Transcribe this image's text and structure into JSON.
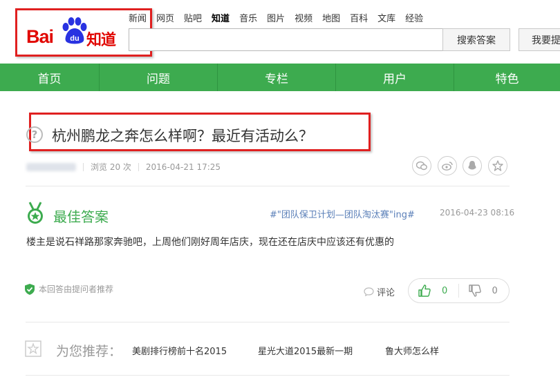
{
  "header": {
    "logo_text_bai": "Bai",
    "logo_text_du": "du",
    "logo_text_zhidao": "知道",
    "topnav": [
      {
        "label": "新闻",
        "active": false
      },
      {
        "label": "网页",
        "active": false
      },
      {
        "label": "贴吧",
        "active": false
      },
      {
        "label": "知道",
        "active": true
      },
      {
        "label": "音乐",
        "active": false
      },
      {
        "label": "图片",
        "active": false
      },
      {
        "label": "视频",
        "active": false
      },
      {
        "label": "地图",
        "active": false
      },
      {
        "label": "百科",
        "active": false
      },
      {
        "label": "文库",
        "active": false
      },
      {
        "label": "经验",
        "active": false
      }
    ],
    "search_value": "",
    "search_button": "搜索答案",
    "ask_button": "我要提问"
  },
  "mainnav": [
    "首页",
    "问题",
    "专栏",
    "用户",
    "特色"
  ],
  "question": {
    "title": "杭州鹏龙之奔怎么样啊？最近有活动么？",
    "views": "浏览 20 次",
    "date": "2016-04-21 17:25",
    "share_icons": [
      "wechat-icon",
      "weibo-icon",
      "qq-icon",
      "favorite-star-icon"
    ]
  },
  "best_answer": {
    "label": "最佳答案",
    "tag": "#\"团队保卫计划—团队淘汰赛\"ing#",
    "date": "2016-04-23 08:16",
    "text": "楼主是说石祥路那家奔驰吧，上周他们刚好周年店庆，现在还在店庆中应该还有优惠的",
    "recommended_by": "本回答由提问者推荐",
    "comment_label": "评论",
    "upvotes": "0",
    "downvotes": "0"
  },
  "recommendations": {
    "label": "为您推荐：",
    "links": [
      "美剧排行榜前十名2015",
      "星光大道2015最新一期",
      "鲁大师怎么样"
    ]
  },
  "colors": {
    "brand_green": "#3dab4f",
    "baidu_red": "#e10601",
    "highlight_red": "#e02020"
  }
}
